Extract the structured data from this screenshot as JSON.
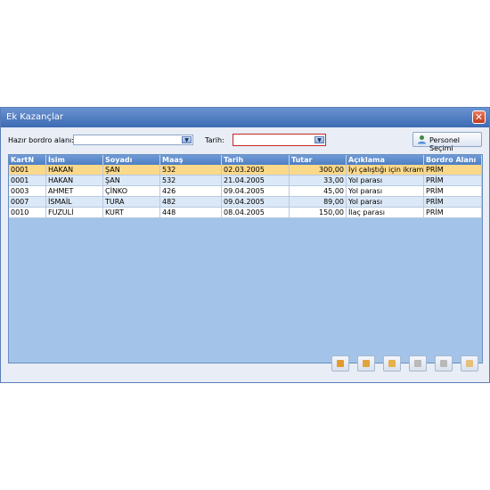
{
  "window": {
    "title": "Ek Kazançlar"
  },
  "filters": {
    "bordro_label": "Hazır bordro alanı:",
    "bordro_value": "",
    "tarih_label": "Tarih:",
    "tarih_value": ""
  },
  "personel_button": {
    "label": "Personel Seçimi",
    "icon": "person-icon"
  },
  "table": {
    "columns": [
      "KartN",
      "İsim",
      "Soyadı",
      "Maaş",
      "Tarih",
      "Tutar",
      "Açıklama",
      "Bordro Alanı"
    ],
    "rows": [
      [
        "0001",
        "HAKAN",
        "ŞAN",
        "532",
        "02.03.2005",
        "300,00",
        "İyi çalıştığı için ikramiye",
        "PRİM"
      ],
      [
        "0001",
        "HAKAN",
        "ŞAN",
        "532",
        "21.04.2005",
        "33,00",
        "Yol parası",
        "PRİM"
      ],
      [
        "0003",
        "AHMET",
        "ÇİNKO",
        "426",
        "09.04.2005",
        "45,00",
        "Yol parası",
        "PRİM"
      ],
      [
        "0007",
        "İSMAİL",
        "TURA",
        "482",
        "09.04.2005",
        "89,00",
        "Yol parası",
        "PRİM"
      ],
      [
        "0010",
        "FUZULİ",
        "KURT",
        "448",
        "08.04.2005",
        "150,00",
        "İlaç parası",
        "PRİM"
      ]
    ],
    "selected_row": 0
  },
  "toolbar": [
    "add-icon",
    "edit-icon",
    "up-icon",
    "disabled-icon",
    "delete-icon",
    "close-icon"
  ],
  "colors": {
    "title_bar": "#4a78bf",
    "grid_bg": "#a3c3e8",
    "selected_row": "#fbd98b",
    "alt_row": "#dbe8f7",
    "row": "#ffffff",
    "highlight_border": "#c62828"
  }
}
